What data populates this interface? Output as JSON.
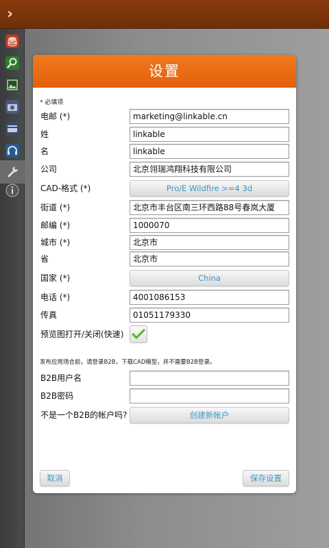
{
  "header": {
    "title": "设置"
  },
  "form": {
    "required_note": "* 必填项",
    "fields": [
      {
        "label": "电邮 (*)",
        "value": "marketing@linkable.cn"
      },
      {
        "label": "姓",
        "value": "linkable"
      },
      {
        "label": "名",
        "value": "linkable"
      },
      {
        "label": "公司",
        "value": "北京翎瑞鸿翔科技有限公司"
      }
    ],
    "cad": {
      "label": "CAD-格式 (*)",
      "value": "Pro/E Wildfire >=4 3d"
    },
    "address": [
      {
        "label": "街道 (*)",
        "value": "北京市丰台区南三环西路88号春岚大厦"
      },
      {
        "label": "邮编 (*)",
        "value": "1000070"
      },
      {
        "label": "城市 (*)",
        "value": "北京市"
      },
      {
        "label": "省",
        "value": "北京市"
      }
    ],
    "country": {
      "label": "国家 (*)",
      "value": "China"
    },
    "phone": {
      "label": "电话 (*)",
      "value": "4001086153"
    },
    "fax": {
      "label": "传真",
      "value": "01051179330"
    },
    "preview": {
      "label": "预览图打开/关闭(快速)",
      "checked": true
    },
    "notice": "发布应用场合前，请登录B2B，下载CAD模型，并不需要B2B登录。",
    "b2b_user": {
      "label": "B2B用户名",
      "value": ""
    },
    "b2b_pass": {
      "label": "B2B密码",
      "value": ""
    },
    "no_account": {
      "label": "不是一个B2B的帐户吗?",
      "button": "创建新帐户"
    }
  },
  "actions": {
    "cancel": "取消",
    "save": "保存设置"
  },
  "sidebar": {
    "icons": [
      "layers-icon",
      "search-icon",
      "image-icon",
      "camera-icon",
      "card-icon",
      "headset-icon",
      "wrench-icon",
      "info-icon"
    ],
    "active_index": 6
  },
  "colors": {
    "accent": "#e8670f",
    "topbar": "#7a340a",
    "link": "#3c96c4"
  }
}
